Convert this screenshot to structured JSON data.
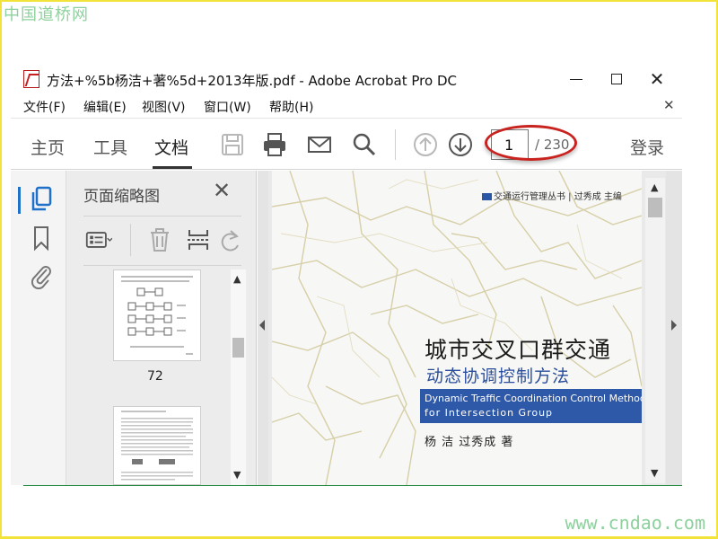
{
  "watermark": {
    "top": "中国道桥网",
    "bottom": "www.cndao.com"
  },
  "window": {
    "title": "方法+%5b杨洁+著%5d+2013年版.pdf - Adobe Acrobat Pro DC"
  },
  "menu": {
    "items": [
      "文件(F)",
      "编辑(E)",
      "视图(V)",
      "窗口(W)",
      "帮助(H)"
    ]
  },
  "toolbar": {
    "tabs": [
      "主页",
      "工具",
      "文档"
    ],
    "active_tab": "文档",
    "page_current": "1",
    "page_total": "/ 230",
    "login": "登录",
    "icons": [
      "save-icon",
      "print-icon",
      "email-icon",
      "search-icon",
      "page-up-icon",
      "page-down-icon"
    ]
  },
  "thumbnail_panel": {
    "title": "页面缩略图",
    "page_label": "72"
  },
  "cover": {
    "series": "交通运行管理丛书 | 过秀成 主编",
    "title": "城市交叉口群交通",
    "subtitle": "动态协调控制方法",
    "english_line1": "Dynamic Traffic Coordination Control Method",
    "english_line2": "for Intersection Group",
    "authors": "杨 洁    过秀成  著"
  },
  "colors": {
    "accent_blue": "#1e70c9",
    "annotation_red": "#c8231f",
    "cover_band": "#2e58a8",
    "frame_yellow": "#f2e33a"
  }
}
